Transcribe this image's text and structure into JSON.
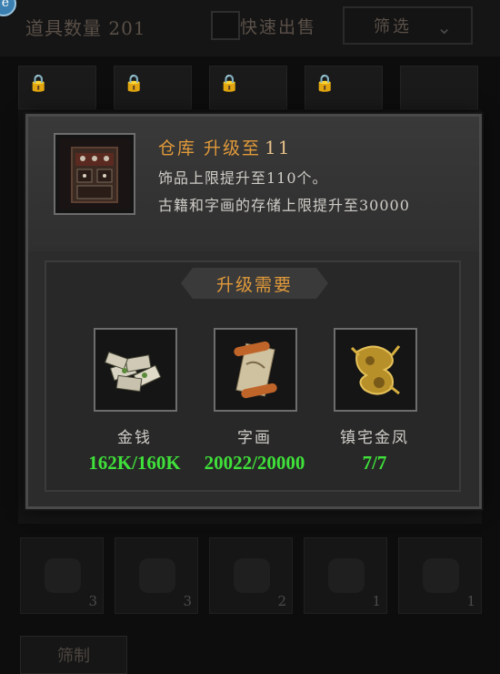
{
  "background": {
    "item_count_label": "道具数量",
    "item_count_value": "201",
    "quick_sell_label": "快速出售",
    "filter_label": "筛选",
    "bottom_slot_counts": [
      "3",
      "3",
      "2",
      "1",
      "1"
    ],
    "bottom_tab_label": "筛制"
  },
  "dialog": {
    "title_prefix": "仓库 升级至",
    "title_level": "11",
    "desc_line1": "饰品上限提升至110个。",
    "desc_line2": "古籍和字画的存储上限提升至30000",
    "requirements_header": "升级需要",
    "requirements": [
      {
        "icon": "money-icon",
        "name": "金钱",
        "value": "162K/160K"
      },
      {
        "icon": "scroll-painting-icon",
        "name": "字画",
        "value": "20022/20000"
      },
      {
        "icon": "golden-phoenix-icon",
        "name": "镇宅金凤",
        "value": "7/7"
      }
    ]
  },
  "colors": {
    "title_orange": "#e19a3a",
    "value_green": "#3fe13a",
    "text_light": "#d0cdc8"
  }
}
